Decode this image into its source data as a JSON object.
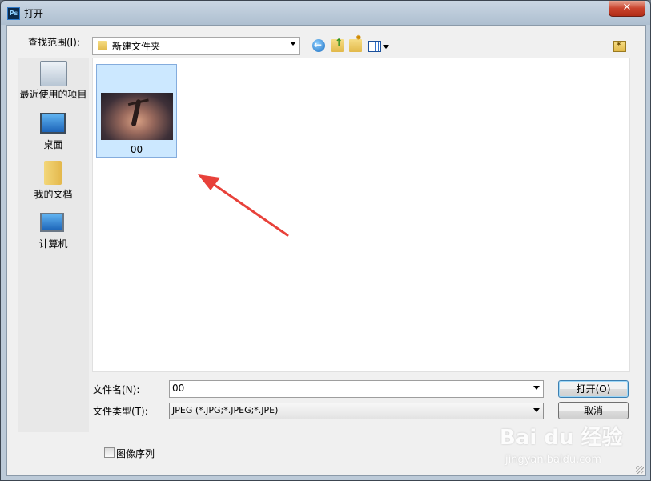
{
  "window": {
    "title": "打开",
    "app_icon": "Ps",
    "close_glyph": "✕"
  },
  "toolbar": {
    "look_in_label": "查找范围(I):",
    "look_in_value": "新建文件夹",
    "back_icon": "back-icon",
    "up_icon": "up-folder-icon",
    "new_folder_icon": "new-folder-icon",
    "view_icon": "view-menu-icon"
  },
  "places": [
    {
      "label": "最近使用的项目",
      "icon": "recent-items-icon"
    },
    {
      "label": "桌面",
      "icon": "desktop-icon"
    },
    {
      "label": "我的文档",
      "icon": "documents-icon"
    },
    {
      "label": "计算机",
      "icon": "computer-icon"
    }
  ],
  "files": [
    {
      "name": "00",
      "selected": true
    }
  ],
  "bottom": {
    "file_name_label": "文件名(N):",
    "file_name_value": "00",
    "file_type_label": "文件类型(T):",
    "file_type_value": "JPEG (*.JPG;*.JPEG;*.JPE)",
    "open_button": "打开(O)",
    "cancel_button": "取消",
    "image_sequence_label": "图像序列",
    "image_sequence_checked": false
  },
  "annotation": {
    "arrow_color": "#e8413a"
  },
  "watermark": {
    "brand": "Bai du 经验",
    "url": "jingyan.baidu.com"
  }
}
